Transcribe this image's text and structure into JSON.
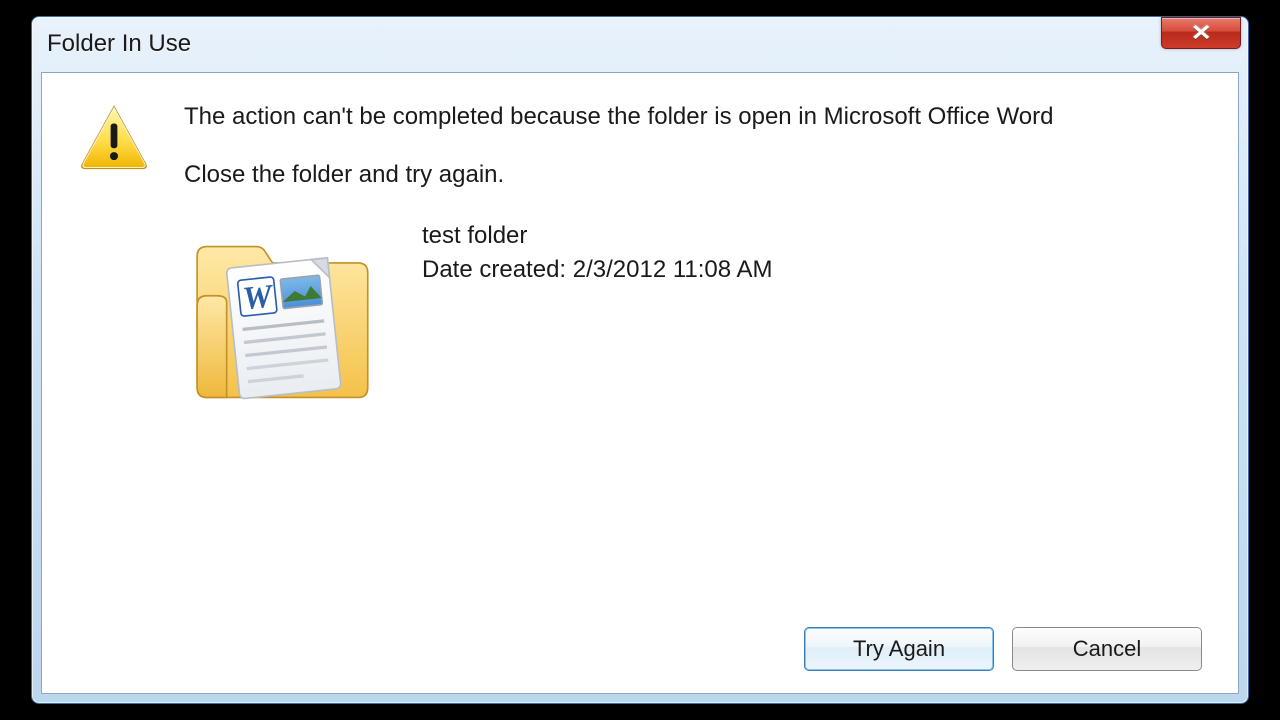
{
  "dialog": {
    "title": "Folder In Use",
    "message_main": "The action can't be completed because the folder is open in Microsoft Office Word",
    "message_sub": "Close the folder and try again.",
    "item": {
      "name": "test folder",
      "date_created_line": "Date created: 2/3/2012 11:08 AM"
    },
    "buttons": {
      "try_again": "Try Again",
      "cancel": "Cancel"
    }
  }
}
